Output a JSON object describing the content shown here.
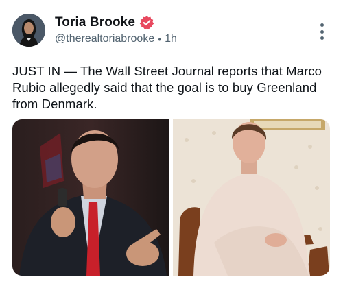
{
  "author": {
    "name": "Toria Brooke",
    "handle": "@therealtoriabrooke",
    "time": "1h",
    "separator": "•",
    "verified_icon": "verified-badge-icon",
    "verified_color": "#e8495f"
  },
  "post": {
    "text": "JUST IN — The Wall Street Journal reports that Marco Rubio allegedly said that the goal is to buy Greenland from Denmark."
  },
  "media": [
    {
      "description": "photo-man-speaking-microphone"
    },
    {
      "description": "photo-woman-seated-chair"
    }
  ],
  "icons": {
    "more": "more-vertical-icon"
  }
}
